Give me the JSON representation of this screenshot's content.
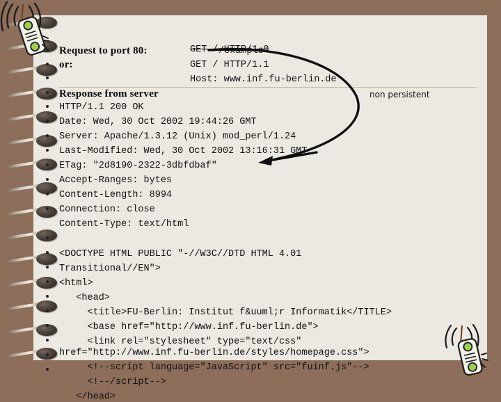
{
  "slide": {
    "background_color": "#8d6e5a",
    "paper_color": "#ece8e2",
    "divider_color": "#c8b996"
  },
  "icons": {
    "top_left": "mobile-phone-antenna-icon",
    "bottom_right": "mobile-phone-antenna-icon",
    "binder": "spiral-binder-ring"
  },
  "request": {
    "heading": "Request to port 80:",
    "or_label": "or:",
    "line1_base": "GET / HTTP/1.0",
    "line1_overlay": "/example",
    "line1_prefix": "GET ",
    "line2": "GET / HTTP/1.1",
    "line3": "Host: www.inf.fu-berlin.de"
  },
  "annotation": {
    "non_persistent": "non persistent"
  },
  "response": {
    "heading": "Response from server",
    "lines": [
      "HTTP/1.1 200 OK",
      "Date: Wed, 30 Oct 2002 19:44:26 GMT",
      "Server: Apache/1.3.12 (Unix) mod_perl/1.24",
      "Last-Modified: Wed, 30 Oct 2002 13:16:31 GMT",
      "ETag: \"2d8190-2322-3dbfdbaf\"",
      "Accept-Ranges: bytes",
      "Content-Length: 8994",
      "Connection: close",
      "Content-Type: text/html"
    ]
  },
  "body_html": {
    "lines": [
      "<DOCTYPE HTML PUBLIC \"-//W3C//DTD HTML 4.01",
      "Transitional//EN\">",
      "<html>",
      "   <head>",
      "     <title>FU-Berlin: Institut f&uuml;r Informatik</TITLE>",
      "     <base href=\"http://www.inf.fu-berlin.de\">",
      "     <link rel=\"stylesheet\" type=\"text/css\"",
      "href=\"http://www.inf.fu-berlin.de/styles/homepage.css\">",
      "     <!--script language=\"JavaScript\" src=\"fuinf.js\"-->",
      "     <!--/script-->",
      "   </head>"
    ]
  }
}
